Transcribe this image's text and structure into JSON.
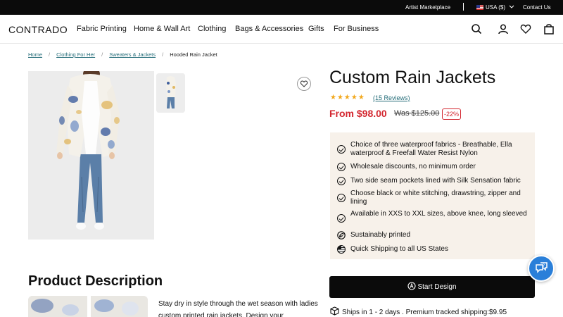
{
  "topbar": {
    "artist_marketplace": "Artist Marketplace",
    "currency": "USA ($)",
    "contact": "Contact Us"
  },
  "header": {
    "logo": "CONTRADO",
    "nav": [
      "Fabric Printing",
      "Home & Wall Art",
      "Clothing",
      "Bags & Accessories",
      "Gifts",
      "For Business"
    ],
    "icons": [
      "search-icon",
      "account-icon",
      "heart-icon",
      "bag-icon"
    ]
  },
  "breadcrumb": {
    "items": [
      "Home",
      "Clothing For Her",
      "Sweaters & Jackets"
    ],
    "current": "Hooded Rain Jacket"
  },
  "product": {
    "title": "Custom Rain Jackets",
    "rating_stars": 5,
    "reviews": "(15 Reviews)",
    "price": "From $98.00",
    "was_price": "Was $125.00",
    "discount": "-22%",
    "features": [
      {
        "icon": "check-icon",
        "text": "Choice of three waterproof fabrics - Breathable, Ella waterproof & Freefall Water Resist Nylon"
      },
      {
        "icon": "check-icon",
        "text": "Wholesale discounts, no minimum order"
      },
      {
        "icon": "check-icon",
        "text": "Two side seam pockets lined with Silk Sensation fabric"
      },
      {
        "icon": "check-icon",
        "text": "Choose black or white stitching, drawstring, zipper and lining"
      },
      {
        "icon": "check-icon",
        "text": "Available in XXS to XXL sizes, above knee, long sleeved"
      },
      {
        "icon": "leaf-icon",
        "text": "Sustainably printed"
      },
      {
        "icon": "us-flag-icon",
        "text": "Quick Shipping to all US States"
      }
    ],
    "cta": "Start Design",
    "shipping": "Ships in 1 - 2 days . Premium tracked shipping:$9.95"
  },
  "description": {
    "title": "Product Description",
    "text": "Stay dry in style through the wet season with ladies custom printed rain jackets. Design your"
  },
  "colors": {
    "accent_link": "#256d79",
    "price_red": "#d3262f",
    "star": "#f2a81d",
    "feature_bg": "#f7f1ea",
    "chat_blue": "#2a7fd9"
  }
}
